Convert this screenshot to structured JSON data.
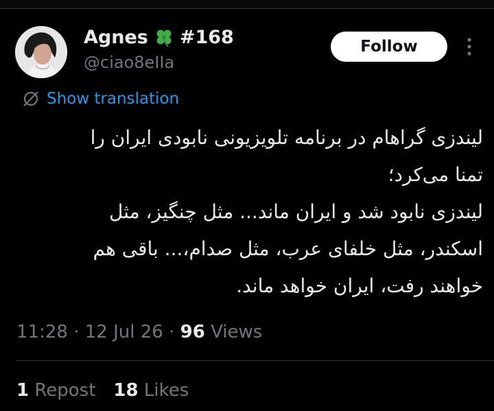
{
  "author": {
    "name": "Agnes",
    "tag": "#168",
    "handle": "@ciao8eIIa",
    "clover_icon": "four-leaf-clover-icon",
    "clover_color": "#3fae49"
  },
  "actions": {
    "follow_label": "Follow",
    "more_icon": "more-dots-vertical-icon"
  },
  "translation": {
    "label": "Show translation",
    "icon": "globe-slash-icon"
  },
  "tweet": {
    "text": "لیندزی گراهام در برنامه تلویزیونی نابودی ایران را\nتمنا می‌کرد؛\nلیندزی نابود شد و ایران ماند... مثل چنگیز، مثل\nاسکندر، مثل خلفای عرب، مثل صدام،... باقی هم\nخواهند رفت، ایران خواهد ماند."
  },
  "meta": {
    "time": "11:28",
    "date": "12 Jul 26",
    "separator": "·",
    "views_count": "96",
    "views_label": "Views"
  },
  "stats": {
    "reposts_count": "1",
    "reposts_label": "Repost",
    "likes_count": "18",
    "likes_label": "Likes"
  },
  "colors": {
    "background": "#000000",
    "text": "#e7e9ea",
    "secondary": "#71767b",
    "link": "#1d9bf0",
    "divider": "#2f3336"
  }
}
